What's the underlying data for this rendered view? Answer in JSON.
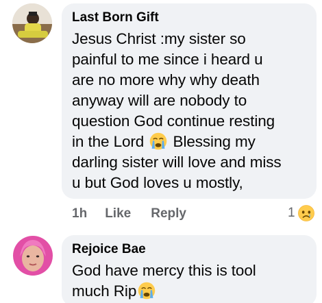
{
  "comments": [
    {
      "author": "Last Born Gift",
      "text_part1": "Jesus Christ :my sister so\npainful to me since i heard u\nare no more why why death\nanyway will are nobody to\nquestion God continue resting\nin the Lord ",
      "emoji": "crying-face-icon",
      "text_part2": " Blessing my\ndarling sister will love and miss\nu but God loves u mostly,",
      "time": "1h",
      "like_label": "Like",
      "reply_label": "Reply",
      "reaction_count": "1",
      "reaction_emoji": "sad-face-icon"
    },
    {
      "author": "Rejoice Bae",
      "text_part1": "God have mercy this is tool\nmuch Rip",
      "emoji": "crying-face-icon"
    }
  ],
  "colors": {
    "bubble": "#f0f2f5",
    "text": "#050505",
    "meta": "#65676b",
    "emoji_yellow": "#ffcc4d"
  }
}
